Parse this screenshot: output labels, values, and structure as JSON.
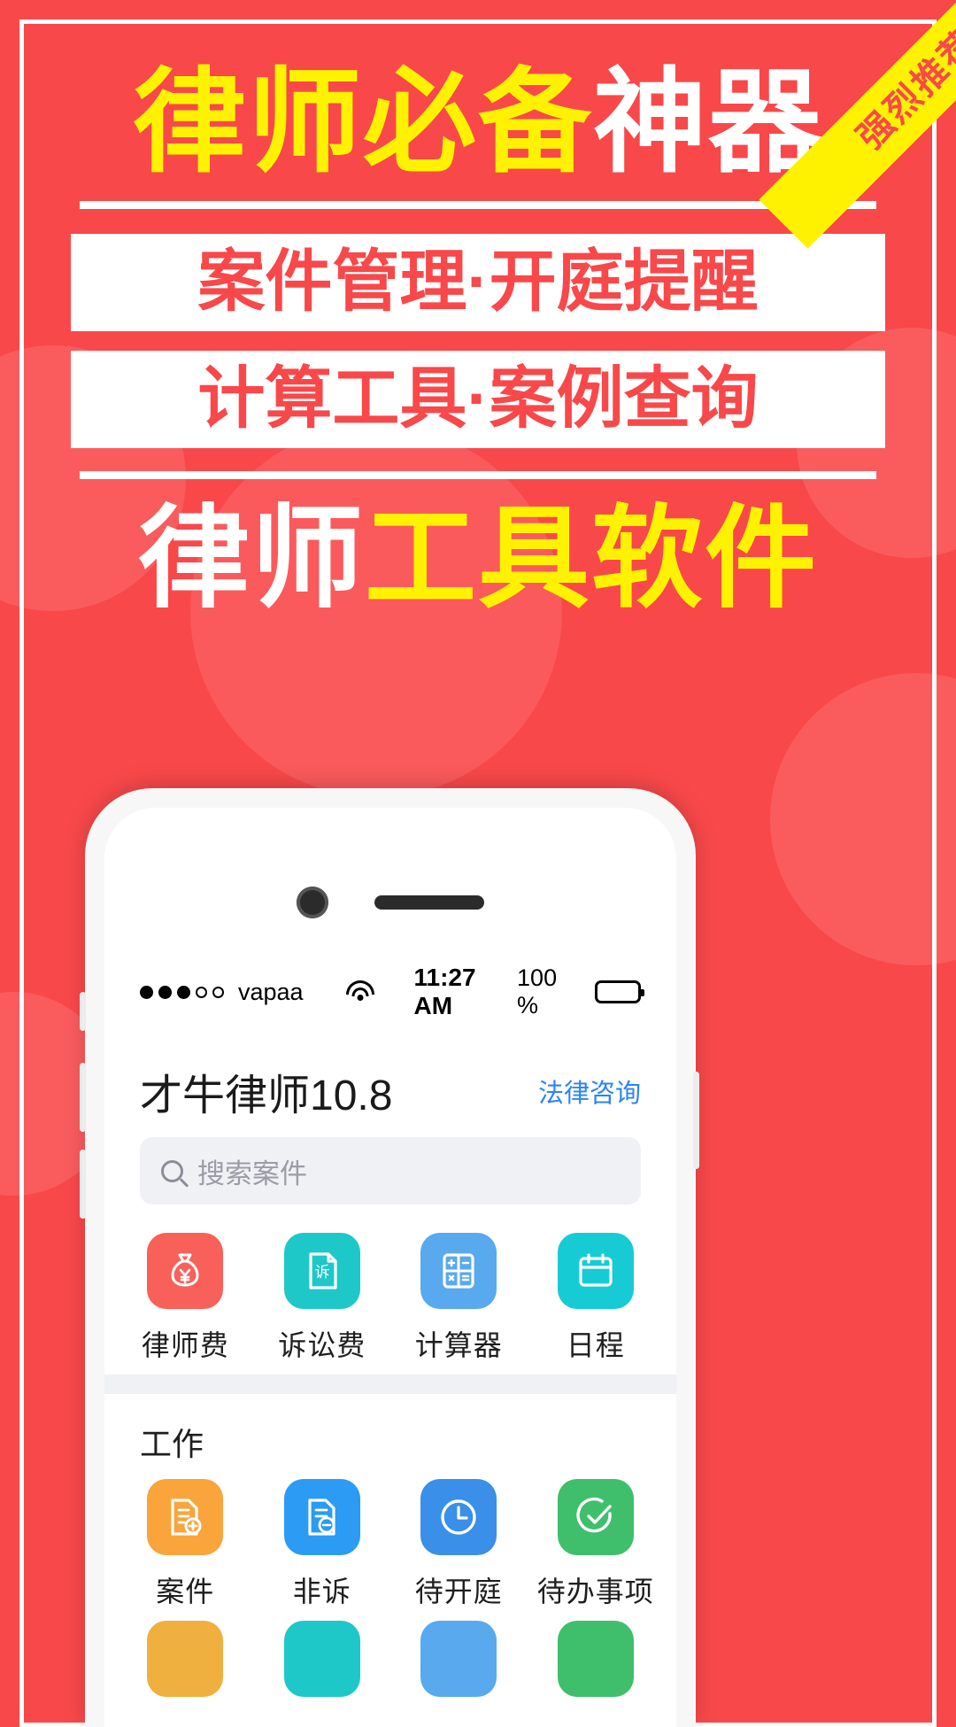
{
  "poster": {
    "background_color": "#F9484A",
    "accent_yellow": "#FFF200",
    "ribbon_text": "强烈推荐",
    "headline_top": {
      "yellow": "律师必备",
      "white": "神器"
    },
    "banner_1": "案件管理·开庭提醒",
    "banner_2": "计算工具·案例查询",
    "headline_bottom": {
      "white": "律师",
      "yellow": "工具软件"
    }
  },
  "phone": {
    "statusbar": {
      "carrier": "vapaa",
      "signal_filled": 3,
      "signal_empty": 2,
      "wifi_icon": "wifi-icon",
      "time": "11:27 AM",
      "battery_percent": "100 %",
      "battery_icon": "battery-full-icon"
    },
    "app": {
      "title": "才牛律师10.8",
      "link": "法律咨询",
      "link_color": "#2B84F7",
      "search_placeholder": "搜索案件",
      "search_icon": "search-icon",
      "section_work_title": "工作"
    },
    "tools": [
      {
        "label": "律师费",
        "icon": "money-bag-icon",
        "color": "#F8615A"
      },
      {
        "label": "诉讼费",
        "icon": "document-su-icon",
        "color": "#1FC8C8"
      },
      {
        "label": "计算器",
        "icon": "calculator-icon",
        "color": "#59A9EF"
      },
      {
        "label": "日程",
        "icon": "calendar-icon",
        "color": "#17CBD4"
      }
    ],
    "work": [
      {
        "label": "案件",
        "icon": "document-add-icon",
        "color": "#F9A53B"
      },
      {
        "label": "非诉",
        "icon": "document-stamp-icon",
        "color": "#2B9BF4"
      },
      {
        "label": "待开庭",
        "icon": "clock-icon",
        "color": "#3A8FE8"
      },
      {
        "label": "待办事项",
        "icon": "check-circle-icon",
        "color": "#3FBF6C"
      }
    ],
    "work_row2": [
      {
        "icon": "tile-icon",
        "color": "#F0B040"
      },
      {
        "icon": "tile-icon",
        "color": "#1FC8C8"
      },
      {
        "icon": "tile-icon",
        "color": "#59A9EF"
      },
      {
        "icon": "tile-icon",
        "color": "#3FBF6C"
      }
    ]
  }
}
